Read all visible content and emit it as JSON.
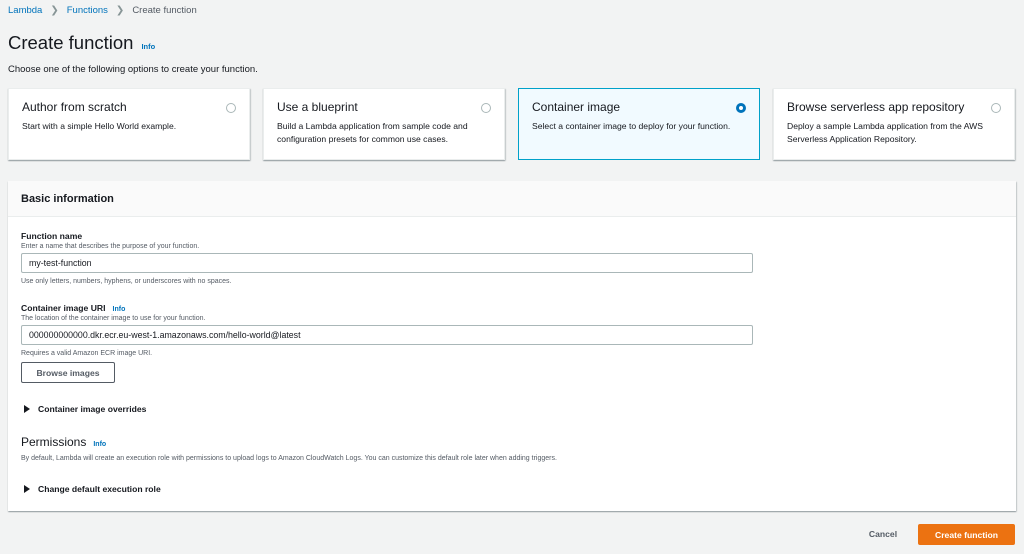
{
  "breadcrumb": {
    "items": [
      "Lambda",
      "Functions"
    ],
    "current": "Create function"
  },
  "page": {
    "title": "Create function",
    "info": "Info",
    "subtitle": "Choose one of the following options to create your function."
  },
  "options": [
    {
      "title": "Author from scratch",
      "desc": "Start with a simple Hello World example.",
      "selected": false
    },
    {
      "title": "Use a blueprint",
      "desc": "Build a Lambda application from sample code and configuration presets for common use cases.",
      "selected": false
    },
    {
      "title": "Container image",
      "desc": "Select a container image to deploy for your function.",
      "selected": true
    },
    {
      "title": "Browse serverless app repository",
      "desc": "Deploy a sample Lambda application from the AWS Serverless Application Repository.",
      "selected": false
    }
  ],
  "basic": {
    "header": "Basic information",
    "function_name": {
      "label": "Function name",
      "desc": "Enter a name that describes the purpose of your function.",
      "value": "my-test-function",
      "hint": "Use only letters, numbers, hyphens, or underscores with no spaces."
    },
    "image_uri": {
      "label": "Container image URI",
      "info": "Info",
      "desc": "The location of the container image to use for your function.",
      "value": "000000000000.dkr.ecr.eu-west-1.amazonaws.com/hello-world@latest",
      "hint": "Requires a valid Amazon ECR image URI."
    },
    "browse_button": "Browse images",
    "overrides": "Container image overrides",
    "permissions": {
      "title": "Permissions",
      "info": "Info",
      "desc": "By default, Lambda will create an execution role with permissions to upload logs to Amazon CloudWatch Logs. You can customize this default role later when adding triggers.",
      "expander": "Change default execution role"
    }
  },
  "footer": {
    "cancel": "Cancel",
    "create": "Create function"
  },
  "colors": {
    "link": "#0073bb",
    "primary_button": "#ec7211",
    "selected_border": "#00a1c9",
    "selected_bg": "#f1faff"
  }
}
